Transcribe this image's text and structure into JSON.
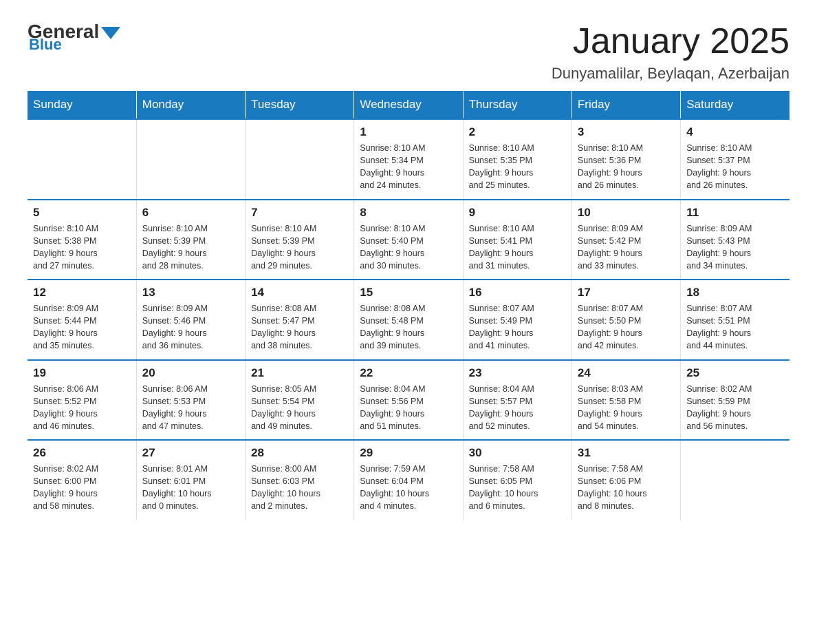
{
  "header": {
    "logo_general": "General",
    "logo_blue": "Blue",
    "month_title": "January 2025",
    "location": "Dunyamalilar, Beylaqan, Azerbaijan"
  },
  "days_of_week": [
    "Sunday",
    "Monday",
    "Tuesday",
    "Wednesday",
    "Thursday",
    "Friday",
    "Saturday"
  ],
  "weeks": [
    [
      {
        "num": "",
        "info": ""
      },
      {
        "num": "",
        "info": ""
      },
      {
        "num": "",
        "info": ""
      },
      {
        "num": "1",
        "info": "Sunrise: 8:10 AM\nSunset: 5:34 PM\nDaylight: 9 hours\nand 24 minutes."
      },
      {
        "num": "2",
        "info": "Sunrise: 8:10 AM\nSunset: 5:35 PM\nDaylight: 9 hours\nand 25 minutes."
      },
      {
        "num": "3",
        "info": "Sunrise: 8:10 AM\nSunset: 5:36 PM\nDaylight: 9 hours\nand 26 minutes."
      },
      {
        "num": "4",
        "info": "Sunrise: 8:10 AM\nSunset: 5:37 PM\nDaylight: 9 hours\nand 26 minutes."
      }
    ],
    [
      {
        "num": "5",
        "info": "Sunrise: 8:10 AM\nSunset: 5:38 PM\nDaylight: 9 hours\nand 27 minutes."
      },
      {
        "num": "6",
        "info": "Sunrise: 8:10 AM\nSunset: 5:39 PM\nDaylight: 9 hours\nand 28 minutes."
      },
      {
        "num": "7",
        "info": "Sunrise: 8:10 AM\nSunset: 5:39 PM\nDaylight: 9 hours\nand 29 minutes."
      },
      {
        "num": "8",
        "info": "Sunrise: 8:10 AM\nSunset: 5:40 PM\nDaylight: 9 hours\nand 30 minutes."
      },
      {
        "num": "9",
        "info": "Sunrise: 8:10 AM\nSunset: 5:41 PM\nDaylight: 9 hours\nand 31 minutes."
      },
      {
        "num": "10",
        "info": "Sunrise: 8:09 AM\nSunset: 5:42 PM\nDaylight: 9 hours\nand 33 minutes."
      },
      {
        "num": "11",
        "info": "Sunrise: 8:09 AM\nSunset: 5:43 PM\nDaylight: 9 hours\nand 34 minutes."
      }
    ],
    [
      {
        "num": "12",
        "info": "Sunrise: 8:09 AM\nSunset: 5:44 PM\nDaylight: 9 hours\nand 35 minutes."
      },
      {
        "num": "13",
        "info": "Sunrise: 8:09 AM\nSunset: 5:46 PM\nDaylight: 9 hours\nand 36 minutes."
      },
      {
        "num": "14",
        "info": "Sunrise: 8:08 AM\nSunset: 5:47 PM\nDaylight: 9 hours\nand 38 minutes."
      },
      {
        "num": "15",
        "info": "Sunrise: 8:08 AM\nSunset: 5:48 PM\nDaylight: 9 hours\nand 39 minutes."
      },
      {
        "num": "16",
        "info": "Sunrise: 8:07 AM\nSunset: 5:49 PM\nDaylight: 9 hours\nand 41 minutes."
      },
      {
        "num": "17",
        "info": "Sunrise: 8:07 AM\nSunset: 5:50 PM\nDaylight: 9 hours\nand 42 minutes."
      },
      {
        "num": "18",
        "info": "Sunrise: 8:07 AM\nSunset: 5:51 PM\nDaylight: 9 hours\nand 44 minutes."
      }
    ],
    [
      {
        "num": "19",
        "info": "Sunrise: 8:06 AM\nSunset: 5:52 PM\nDaylight: 9 hours\nand 46 minutes."
      },
      {
        "num": "20",
        "info": "Sunrise: 8:06 AM\nSunset: 5:53 PM\nDaylight: 9 hours\nand 47 minutes."
      },
      {
        "num": "21",
        "info": "Sunrise: 8:05 AM\nSunset: 5:54 PM\nDaylight: 9 hours\nand 49 minutes."
      },
      {
        "num": "22",
        "info": "Sunrise: 8:04 AM\nSunset: 5:56 PM\nDaylight: 9 hours\nand 51 minutes."
      },
      {
        "num": "23",
        "info": "Sunrise: 8:04 AM\nSunset: 5:57 PM\nDaylight: 9 hours\nand 52 minutes."
      },
      {
        "num": "24",
        "info": "Sunrise: 8:03 AM\nSunset: 5:58 PM\nDaylight: 9 hours\nand 54 minutes."
      },
      {
        "num": "25",
        "info": "Sunrise: 8:02 AM\nSunset: 5:59 PM\nDaylight: 9 hours\nand 56 minutes."
      }
    ],
    [
      {
        "num": "26",
        "info": "Sunrise: 8:02 AM\nSunset: 6:00 PM\nDaylight: 9 hours\nand 58 minutes."
      },
      {
        "num": "27",
        "info": "Sunrise: 8:01 AM\nSunset: 6:01 PM\nDaylight: 10 hours\nand 0 minutes."
      },
      {
        "num": "28",
        "info": "Sunrise: 8:00 AM\nSunset: 6:03 PM\nDaylight: 10 hours\nand 2 minutes."
      },
      {
        "num": "29",
        "info": "Sunrise: 7:59 AM\nSunset: 6:04 PM\nDaylight: 10 hours\nand 4 minutes."
      },
      {
        "num": "30",
        "info": "Sunrise: 7:58 AM\nSunset: 6:05 PM\nDaylight: 10 hours\nand 6 minutes."
      },
      {
        "num": "31",
        "info": "Sunrise: 7:58 AM\nSunset: 6:06 PM\nDaylight: 10 hours\nand 8 minutes."
      },
      {
        "num": "",
        "info": ""
      }
    ]
  ]
}
